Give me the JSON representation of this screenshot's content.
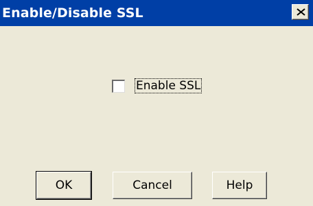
{
  "window": {
    "title": "Enable/Disable SSL",
    "close_icon": "close-icon"
  },
  "ssl": {
    "label": "Enable SSL",
    "checked": false
  },
  "buttons": {
    "ok_label": "OK",
    "cancel_label": "Cancel",
    "help_label": "Help"
  },
  "colors": {
    "titlebar": "#003fa6",
    "dialog_bg": "#ece9d8",
    "title_text": "#ffffff"
  }
}
